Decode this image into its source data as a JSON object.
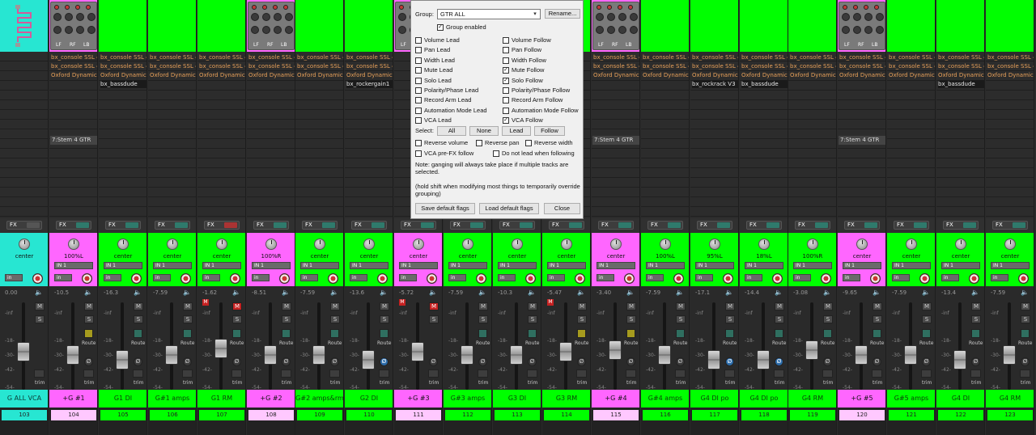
{
  "strips": [
    {
      "number": "103",
      "name": "G ALL VCA",
      "color": "#27e6d2",
      "thumb": "cable",
      "fx": [],
      "stem": "",
      "fx_state": "dim",
      "pan": "center",
      "in": "",
      "vol": "0.00",
      "fader_pos": 0.55,
      "rm": false,
      "mute_red": false,
      "route_yel": false,
      "phase_blue": false,
      "num_style": "cyan",
      "has_phase": false,
      "route": false
    },
    {
      "number": "104",
      "name": "+G #1",
      "color": "#ff66ff",
      "thumb": "pedal",
      "fx": [
        "bx_console SSL 4",
        "bx_console SSL 4",
        "Oxford Dynamic"
      ],
      "extra": "",
      "stem": "7:Stem 4 GTR",
      "fx_state": "on",
      "pan": "100%L",
      "in": "IN 1",
      "vol": "-10.5",
      "fader_pos": 0.62,
      "rm": false,
      "mute_red": false,
      "route_yel": true,
      "phase_blue": false,
      "num_style": "pink",
      "has_phase": true,
      "route": true
    },
    {
      "number": "105",
      "name": "G1 DI",
      "color": "#00ff00",
      "thumb": "plain",
      "fx": [
        "bx_console SSL 4",
        "bx_console SSL 4",
        "Oxford Dynamic"
      ],
      "extra": "bx_bassdude",
      "stem": "",
      "fx_state": "on",
      "pan": "center",
      "in": "IN 1",
      "vol": "-16.3",
      "fader_pos": 0.72,
      "rm": false,
      "mute_red": false,
      "route_yel": false,
      "phase_blue": false,
      "num_style": "green",
      "has_phase": true,
      "route": true
    },
    {
      "number": "106",
      "name": "G#1 amps",
      "color": "#00ff00",
      "thumb": "plain",
      "fx": [
        "bx_console SSL 4",
        "bx_console SSL 4",
        "Oxford Dynamic"
      ],
      "extra": "",
      "stem": "",
      "fx_state": "on",
      "pan": "center",
      "in": "IN 1",
      "vol": "-7.59",
      "fader_pos": 0.62,
      "rm": false,
      "mute_red": false,
      "route_yel": false,
      "phase_blue": false,
      "num_style": "green",
      "has_phase": true,
      "route": true
    },
    {
      "number": "107",
      "name": "G1 RM",
      "color": "#00ff00",
      "thumb": "plain",
      "fx": [
        "bx_console SSL 4",
        "bx_console SSL 4",
        "Oxford Dynamic"
      ],
      "extra": "",
      "stem": "",
      "fx_state": "red",
      "pan": "center",
      "in": "IN 1",
      "vol": "-1.62",
      "fader_pos": 0.48,
      "rm": true,
      "mute_red": true,
      "route_yel": false,
      "phase_blue": false,
      "num_style": "green",
      "has_phase": true,
      "route": true
    },
    {
      "number": "108",
      "name": "+G #2",
      "color": "#ff66ff",
      "thumb": "pedal",
      "fx": [
        "bx_console SSL 4",
        "bx_console SSL 4",
        "Oxford Dynamic"
      ],
      "extra": "",
      "stem": "",
      "fx_state": "on",
      "pan": "100%R",
      "in": "IN 1",
      "vol": "-8.51",
      "fader_pos": 0.62,
      "rm": false,
      "mute_red": false,
      "route_yel": false,
      "phase_blue": false,
      "num_style": "pink",
      "has_phase": true,
      "route": true
    },
    {
      "number": "109",
      "name": "G#2 amps&rm",
      "color": "#00ff00",
      "thumb": "plain",
      "fx": [
        "bx_console SSL 4",
        "bx_console SSL 4",
        "Oxford Dynamic"
      ],
      "extra": "",
      "stem": "",
      "fx_state": "on",
      "pan": "center",
      "in": "IN 1",
      "vol": "-7.59",
      "fader_pos": 0.62,
      "rm": false,
      "mute_red": false,
      "route_yel": false,
      "phase_blue": false,
      "num_style": "green",
      "has_phase": true,
      "route": true
    },
    {
      "number": "110",
      "name": "G2 DI",
      "color": "#00ff00",
      "thumb": "plain",
      "fx": [
        "bx_console SSL 4",
        "bx_console SSL 4",
        "Oxford Dynamic"
      ],
      "extra": "bx_rockergain1",
      "stem": "",
      "fx_state": "on",
      "pan": "center",
      "in": "IN 1",
      "vol": "-13.6",
      "fader_pos": 0.72,
      "rm": false,
      "mute_red": false,
      "route_yel": false,
      "phase_blue": true,
      "num_style": "green",
      "has_phase": true,
      "route": true
    },
    {
      "number": "111",
      "name": "+G #3",
      "color": "#ff66ff",
      "thumb": "pedal",
      "fx": [],
      "extra": "",
      "stem": "",
      "fx_state": "on",
      "pan": "center",
      "in": "IN 1",
      "vol": "-5.72",
      "fader_pos": 0.55,
      "rm": true,
      "mute_red": true,
      "route_yel": false,
      "phase_blue": false,
      "num_style": "pink",
      "has_phase": true,
      "route": false
    },
    {
      "number": "112",
      "name": "G#3 amps",
      "color": "#00ff00",
      "thumb": "plain",
      "fx": [],
      "extra": "",
      "stem": "",
      "fx_state": "on",
      "pan": "center",
      "in": "IN 1",
      "vol": "-7.59",
      "fader_pos": 0.62,
      "rm": false,
      "mute_red": false,
      "route_yel": false,
      "phase_blue": false,
      "num_style": "green",
      "has_phase": true,
      "route": true
    },
    {
      "number": "113",
      "name": "G3 DI",
      "color": "#00ff00",
      "thumb": "plain",
      "fx": [],
      "extra": "",
      "stem": "",
      "fx_state": "on",
      "pan": "center",
      "in": "IN 1",
      "vol": "-10.3",
      "fader_pos": 0.62,
      "rm": false,
      "mute_red": false,
      "route_yel": false,
      "phase_blue": false,
      "num_style": "green",
      "has_phase": true,
      "route": true
    },
    {
      "number": "114",
      "name": "G3 RM",
      "color": "#00ff00",
      "thumb": "plain",
      "fx": [],
      "extra": "",
      "stem": "",
      "fx_state": "on",
      "pan": "center",
      "in": "IN 1",
      "vol": "-5.47",
      "fader_pos": 0.55,
      "rm": true,
      "mute_red": false,
      "route_yel": true,
      "phase_blue": false,
      "num_style": "green",
      "has_phase": true,
      "route": true
    },
    {
      "number": "115",
      "name": "+G #4",
      "color": "#ff66ff",
      "thumb": "pedal",
      "fx": [
        "bx_console SSL 4",
        "bx_console SSL 4",
        "Oxford Dynamic"
      ],
      "extra": "",
      "stem": "7:Stem 4 GTR",
      "fx_state": "on",
      "pan": "center",
      "in": "IN 1",
      "vol": "-3.40",
      "fader_pos": 0.52,
      "rm": false,
      "mute_red": false,
      "route_yel": true,
      "phase_blue": false,
      "num_style": "pink",
      "has_phase": true,
      "route": true
    },
    {
      "number": "116",
      "name": "G#4 amps",
      "color": "#00ff00",
      "thumb": "plain",
      "fx": [
        "bx_console SSL 4",
        "bx_console SSL 4",
        "Oxford Dynamic"
      ],
      "extra": "",
      "stem": "",
      "fx_state": "on",
      "pan": "100%L",
      "in": "IN 1",
      "vol": "-7.59",
      "fader_pos": 0.62,
      "rm": false,
      "mute_red": false,
      "route_yel": false,
      "phase_blue": false,
      "num_style": "green",
      "has_phase": true,
      "route": true
    },
    {
      "number": "117",
      "name": "G4 DI po",
      "color": "#00ff00",
      "thumb": "plain",
      "fx": [
        "bx_console SSL 4",
        "bx_console SSL 4",
        "Oxford Dynamic"
      ],
      "extra": "bx_rockrack V3",
      "stem": "",
      "fx_state": "on",
      "pan": "95%L",
      "in": "IN 1",
      "vol": "-17.1",
      "fader_pos": 0.72,
      "rm": false,
      "mute_red": false,
      "route_yel": false,
      "phase_blue": true,
      "num_style": "green",
      "has_phase": true,
      "route": true
    },
    {
      "number": "118",
      "name": "G4 DI po",
      "color": "#00ff00",
      "thumb": "plain",
      "fx": [
        "bx_console SSL 4",
        "bx_console SSL 4",
        "Oxford Dynamic"
      ],
      "extra": "bx_bassdude",
      "stem": "",
      "fx_state": "on",
      "pan": "18%L",
      "in": "IN 1",
      "vol": "-14.4",
      "fader_pos": 0.72,
      "rm": false,
      "mute_red": false,
      "route_yel": false,
      "phase_blue": true,
      "num_style": "green",
      "has_phase": true,
      "route": true
    },
    {
      "number": "119",
      "name": "G4 RM",
      "color": "#00ff00",
      "thumb": "plain",
      "fx": [
        "bx_console SSL 4",
        "bx_console SSL 4",
        "Oxford Dynamic"
      ],
      "extra": "",
      "stem": "",
      "fx_state": "on",
      "pan": "100%R",
      "in": "IN 1",
      "vol": "-3.08",
      "fader_pos": 0.52,
      "rm": false,
      "mute_red": false,
      "route_yel": false,
      "phase_blue": false,
      "num_style": "green",
      "has_phase": true,
      "route": true
    },
    {
      "number": "120",
      "name": "+G #5",
      "color": "#ff66ff",
      "thumb": "pedal",
      "fx": [
        "bx_console SSL 4",
        "bx_console SSL 4",
        "Oxford Dynamic"
      ],
      "extra": "",
      "stem": "7:Stem 4 GTR",
      "fx_state": "on",
      "pan": "center",
      "in": "IN 1",
      "vol": "-9.65",
      "fader_pos": 0.62,
      "rm": false,
      "mute_red": false,
      "route_yel": false,
      "phase_blue": false,
      "num_style": "pink",
      "has_phase": true,
      "route": true
    },
    {
      "number": "121",
      "name": "G#5 amps",
      "color": "#00ff00",
      "thumb": "plain",
      "fx": [
        "bx_console SSL 4",
        "bx_console SSL 4",
        "Oxford Dynamic"
      ],
      "extra": "",
      "stem": "",
      "fx_state": "on",
      "pan": "center",
      "in": "IN 1",
      "vol": "-7.59",
      "fader_pos": 0.62,
      "rm": false,
      "mute_red": false,
      "route_yel": false,
      "phase_blue": false,
      "num_style": "green",
      "has_phase": true,
      "route": true
    },
    {
      "number": "122",
      "name": "G4 DI",
      "color": "#00ff00",
      "thumb": "plain",
      "fx": [
        "bx_console SSL 4",
        "bx_console SSL 4",
        "Oxford Dynamic"
      ],
      "extra": "bx_bassdude",
      "stem": "",
      "fx_state": "on",
      "pan": "center",
      "in": "IN 1",
      "vol": "-13.4",
      "fader_pos": 0.72,
      "rm": false,
      "mute_red": false,
      "route_yel": false,
      "phase_blue": false,
      "num_style": "green",
      "has_phase": true,
      "route": true
    },
    {
      "number": "123",
      "name": "G4 RM",
      "color": "#00ff00",
      "thumb": "plain",
      "fx": [
        "bx_console SSL 4",
        "bx_console SSL 4",
        "Oxford Dynamic"
      ],
      "extra": "",
      "stem": "",
      "fx_state": "on",
      "pan": "center",
      "in": "IN 1",
      "vol": "-7.59",
      "fader_pos": 0.62,
      "rm": false,
      "mute_red": false,
      "route_yel": false,
      "phase_blue": false,
      "num_style": "green",
      "has_phase": true,
      "route": true
    }
  ],
  "common": {
    "fx_label": "FX",
    "in_btn": "in",
    "route": "Route",
    "trim": "trim",
    "scale": [
      "-inf",
      "-18-",
      "-30-",
      "-42-",
      "-54-"
    ],
    "m": "M",
    "s": "S",
    "rm": "M",
    "phase": "Ø",
    "speaker": "🔈"
  },
  "pedal_labels": [
    "LF",
    "RF",
    "LB"
  ],
  "group_dialog": {
    "group_label": "Group:",
    "group_value": "GTR ALL",
    "rename": "Rename...",
    "group_enabled": "Group enabled",
    "left_col": [
      "Volume Lead",
      "Pan Lead",
      "Width Lead",
      "Mute Lead",
      "Solo Lead",
      "Polarity/Phase Lead",
      "Record Arm Lead",
      "Automation Mode Lead",
      "VCA Lead"
    ],
    "left_checked": [
      false,
      false,
      false,
      false,
      false,
      false,
      false,
      false,
      false
    ],
    "right_col": [
      "Volume Follow",
      "Pan Follow",
      "Width Follow",
      "Mute Follow",
      "Solo Follow",
      "Polarity/Phase Follow",
      "Record Arm Follow",
      "Automation Mode Follow",
      "VCA Follow"
    ],
    "right_checked": [
      false,
      false,
      false,
      true,
      true,
      false,
      false,
      false,
      true
    ],
    "select_label": "Select:",
    "select_buttons": [
      "All",
      "None",
      "Lead",
      "Follow"
    ],
    "reverse_volume": "Reverse volume",
    "reverse_pan": "Reverse pan",
    "reverse_width": "Reverse width",
    "vca_prefx": "VCA pre-FX follow",
    "no_lead": "Do not lead when following",
    "note1": "Note: ganging will always take place if multiple tracks are selected.",
    "note2": "(hold shift when modifying most things to temporarily override grouping)",
    "save_default": "Save default flags",
    "load_default": "Load default flags",
    "close": "Close"
  }
}
